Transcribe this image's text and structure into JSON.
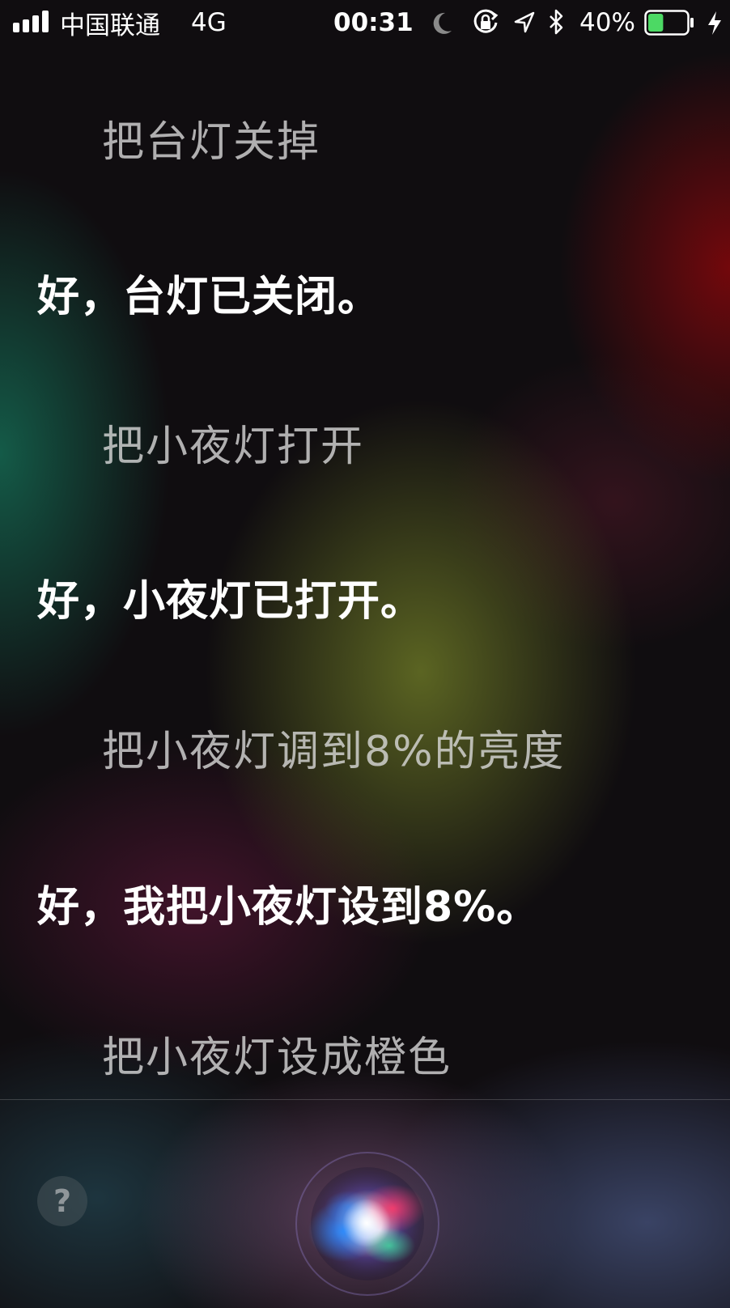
{
  "status_bar": {
    "carrier": "中国联通",
    "network": "4G",
    "time": "00:31",
    "battery_percent": "40%",
    "battery_level": 0.4,
    "icons": [
      "signal-bars-icon",
      "do-not-disturb-moon-icon",
      "orientation-lock-icon",
      "location-arrow-icon",
      "bluetooth-icon",
      "battery-icon",
      "charging-bolt-icon"
    ]
  },
  "conversation": [
    {
      "role": "user",
      "text": "把台灯关掉"
    },
    {
      "role": "siri",
      "text": "好，台灯已关闭。"
    },
    {
      "role": "user",
      "text": "把小夜灯打开"
    },
    {
      "role": "siri",
      "text": "好，小夜灯已打开。"
    },
    {
      "role": "user",
      "text": "把小夜灯调到8%的亮度"
    },
    {
      "role": "siri",
      "text": "好，我把小夜灯设到8%。"
    },
    {
      "role": "user",
      "text": "把小夜灯设成橙色"
    }
  ],
  "bottom_bar": {
    "help_label": "?",
    "siri_button_icon": "siri-orb-icon"
  },
  "colors": {
    "battery_fill": "#4cd964",
    "user_text": "#dedede",
    "siri_text": "#ffffff"
  }
}
